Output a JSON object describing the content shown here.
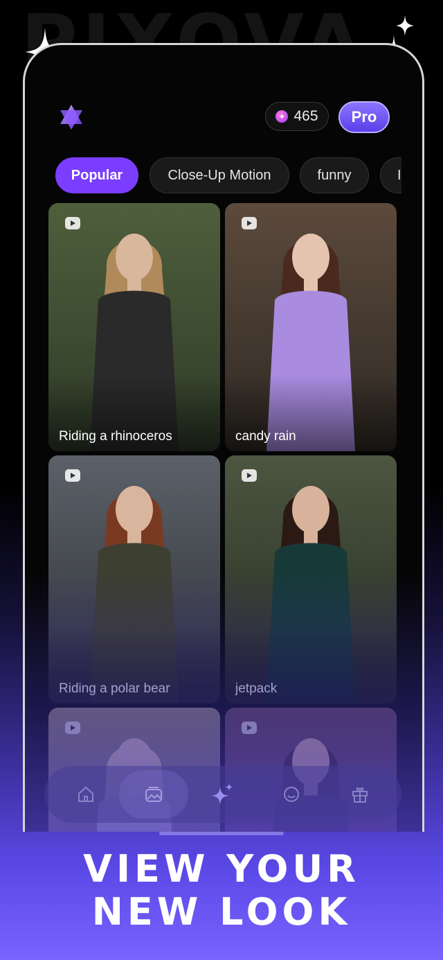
{
  "watermark": "PIXOVA",
  "header": {
    "credits": "465",
    "pro_label": "Pro"
  },
  "chips": [
    "Popular",
    "Close-Up Motion",
    "funny",
    "I"
  ],
  "cards": [
    {
      "label": "Riding a rhinoceros",
      "palette": {
        "bg1": "#4f5f3c",
        "bg2": "#2e3a28",
        "cloth": "#2a2a2a",
        "hair": "#b08a5a",
        "skin": "#d8b79c"
      }
    },
    {
      "label": "candy rain",
      "palette": {
        "bg1": "#5c4a3c",
        "bg2": "#2e2924",
        "cloth": "#a98be0",
        "hair": "#4a2a1f",
        "skin": "#e4c4ae"
      }
    },
    {
      "label": "Riding a polar bear",
      "palette": {
        "bg1": "#5c6068",
        "bg2": "#2d3136",
        "cloth": "#3d3f31",
        "hair": "#7a3a22",
        "skin": "#d9b59d"
      }
    },
    {
      "label": "jetpack",
      "palette": {
        "bg1": "#4c5640",
        "bg2": "#262b22",
        "cloth": "#173a38",
        "hair": "#2b1a14",
        "skin": "#d8b29a"
      }
    },
    {
      "label": "",
      "palette": {
        "bg1": "#9a8f7a",
        "bg2": "#5c5446",
        "cloth": "#c9c0b0",
        "hair": "#e3d3a8",
        "skin": "#e7cdb8"
      }
    },
    {
      "label": "",
      "palette": {
        "bg1": "#6a4a58",
        "bg2": "#3a2630",
        "cloth": "#3a2a2a",
        "hair": "#3a2018",
        "skin": "#dcb69f"
      }
    }
  ],
  "nav": {
    "items": [
      "home-icon",
      "gallery-icon",
      "sparkle-create-icon",
      "smile-icon",
      "gift-icon"
    ]
  },
  "headline": {
    "line1": "VIEW YOUR",
    "line2": "NEW LOOK"
  },
  "colors": {
    "accent": "#7b3dff",
    "pro": "#6a52f0"
  }
}
